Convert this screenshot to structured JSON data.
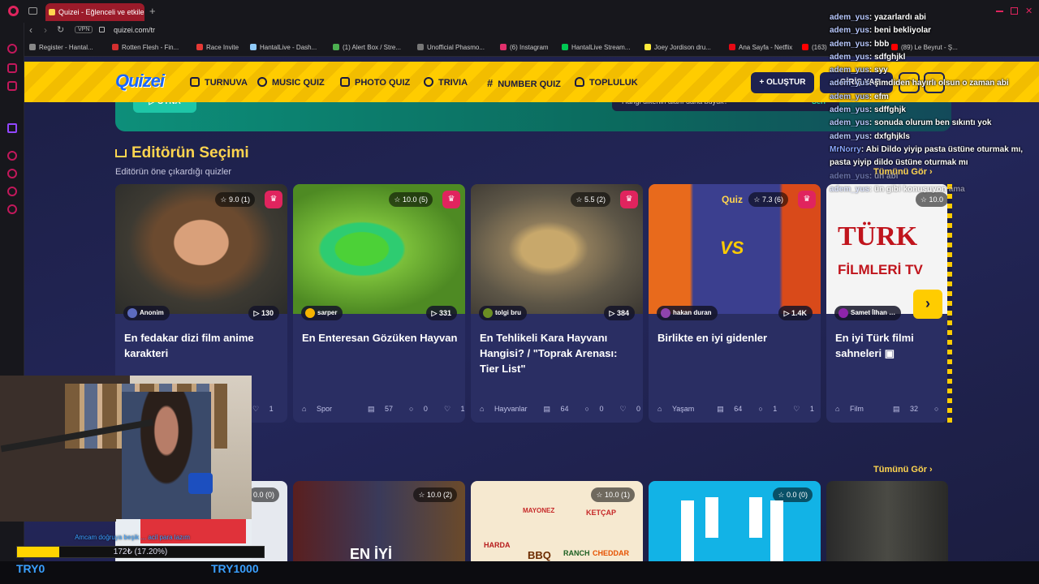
{
  "browser": {
    "tab_title": "Quizei - Eğlenceli ve etkileşimli",
    "url": "quizei.com/tr",
    "vpn_label": "VPN",
    "bookmarks": [
      "Register - Hantal...",
      "Rotten Flesh - Fin...",
      "Race Invite",
      "HantalLive - Dash...",
      "(1) Alert Box / Stre...",
      "Unofficial Phasmo...",
      "(6) Instagram",
      "HantalLive Stream...",
      "Joey Jordison dru...",
      "Ana Sayfa - Netflix",
      "(163)",
      "(89) Le Beyrut - Ş..."
    ]
  },
  "site": {
    "logo": "Quizei",
    "nav": [
      "TURNUVA",
      "MUSIC QUIZ",
      "PHOTO QUIZ",
      "TRIVIA",
      "NUMBER QUIZ",
      "TOPLULUK"
    ],
    "create_label": "+ OLUŞTUR",
    "login_label": "GİRİŞ YAP",
    "banner": {
      "play_label": "OYNA",
      "question": "Hangi ülkenin alanı daha büyük?",
      "next_label": "Seri"
    },
    "section": {
      "title": "Editörün Seçimi",
      "subtitle": "Editörün öne çıkardığı quizler",
      "see_all": "Tümünü Gör ›"
    },
    "cards": [
      {
        "rating": "9.0 (1)",
        "author": "Anonim",
        "plays": "130",
        "title": "En fedakar dizi film anime karakteri",
        "category": "",
        "questions": "",
        "comments": "",
        "likes": "1",
        "img": "a"
      },
      {
        "rating": "10.0 (5)",
        "author": "sarper",
        "plays": "331",
        "title": "En Enteresan Gözüken Hayvan",
        "category": "Spor",
        "questions": "57",
        "comments": "0",
        "likes": "1",
        "img": "b"
      },
      {
        "rating": "5.5 (2)",
        "author": "tolgi bru",
        "plays": "384",
        "title": "En Tehlikeli Kara Hayvanı Hangisi? / \"Toprak Arenası: Tier List\"",
        "category": "Hayvanlar",
        "questions": "64",
        "comments": "0",
        "likes": "0",
        "img": "c"
      },
      {
        "rating": "7.3 (6)",
        "author": "hakan duran",
        "plays": "1.4K",
        "title": "Birlikte en iyi gidenler",
        "category": "Yaşam",
        "questions": "64",
        "comments": "1",
        "likes": "1",
        "img": "d"
      },
      {
        "rating": "10.0",
        "author": "Samet İlhan …",
        "plays": "",
        "title": "En iyi Türk filmi sahneleri ▣",
        "category": "Film",
        "questions": "32",
        "comments": "0",
        "likes": "",
        "img": "e"
      }
    ],
    "card5_image_text": [
      "TÜRK",
      "FİLMLERİ TV"
    ],
    "card4_image_text": [
      "Quiz",
      "VS"
    ],
    "section2_see_all": "Tümünü Gör ›",
    "row2_ratings": [
      "0.0 (0)",
      "10.0 (2)",
      "10.0 (1)",
      "0.0 (0)",
      ""
    ],
    "row2_texts": [
      "EN İYİ",
      "BBQ",
      "RANCH",
      "CHEDDAR",
      "HARDA",
      "MAYONEZ",
      "KETÇAP"
    ]
  },
  "chat": [
    {
      "user": "adem_yus",
      "text": "yazarlardı abi"
    },
    {
      "user": "adem_yus",
      "text": "beni bekliyolar"
    },
    {
      "user": "adem_yus",
      "text": "bbb"
    },
    {
      "user": "adem_yus",
      "text": "sdfghjkl"
    },
    {
      "user": "adem_yus",
      "text": "syy"
    },
    {
      "user": "adem_yus",
      "text": "şimdiden hayırlı olsun o zaman abi"
    },
    {
      "user": "adem_yus",
      "text": "efm"
    },
    {
      "user": "adem_yus",
      "text": "sdffghjk"
    },
    {
      "user": "adem_yus",
      "text": "sonuda olurum ben sıkıntı yok"
    },
    {
      "user": "adem_yus",
      "text": "dxfghjkls"
    },
    {
      "user": "MrNorry",
      "text": "Abi Dildo yiyip pasta üstüne oturmak mı, pasta yiyip dildo üstüne oturmak mı"
    },
    {
      "user": "adem_yus",
      "text": "ün abi"
    },
    {
      "user": "adem_yus",
      "text": "ün gibi konuşuyon ama"
    }
  ],
  "stream": {
    "ticker": "Amcam doğruya beşik ... acil para lazım",
    "progress_label": "172₺ (17.20%)",
    "progress_fraction": 0.172,
    "goal_left": "TRY0",
    "goal_right": "TRY1000"
  },
  "colors": {
    "accent_yellow": "#ffcc00",
    "site_bg": "#1c1f45",
    "card_bg": "#2a2e63",
    "crown_red": "#e0245e",
    "tab_red": "#9b1b2a",
    "stream_blue": "#3aa0ff"
  }
}
